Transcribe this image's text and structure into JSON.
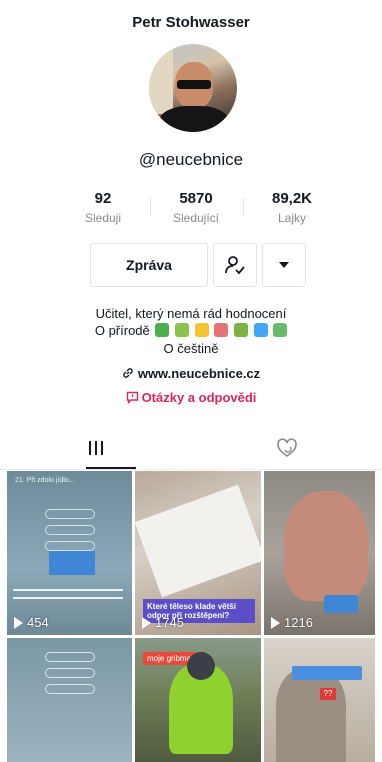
{
  "profile": {
    "display_name": "Petr Stohwasser",
    "handle": "@neucebnice",
    "stats": {
      "following": {
        "value": "92",
        "label": "Sleduji"
      },
      "followers": {
        "value": "5870",
        "label": "Sledující"
      },
      "likes": {
        "value": "89,2K",
        "label": "Lajky"
      }
    },
    "actions": {
      "message_label": "Zpráva"
    },
    "bio": {
      "line1": "Učitel, který nemá rád hodnocení",
      "line2": "O přírodě",
      "line3": "O češtině",
      "emojis": [
        "#4caf50",
        "#8bc34a",
        "#f4c430",
        "#e57373",
        "#7cb342",
        "#42a5f5",
        "#66bb6a"
      ]
    },
    "website": "www.neucebnice.cz",
    "qa_label": "Otázky a odpovědi"
  },
  "videos": [
    {
      "views": "454",
      "caption": ""
    },
    {
      "views": "1745",
      "caption_line1": "Které těleso klade větší",
      "caption_line2": "odpor při rozštěpení?"
    },
    {
      "views": "1216",
      "caption": ""
    },
    {
      "views": ""
    },
    {
      "views": "",
      "tag": "moje gribmany"
    },
    {
      "views": "",
      "badge": "??"
    }
  ],
  "colors": {
    "accent": "#e0245e",
    "text": "#161823",
    "muted": "#8a8b91"
  }
}
